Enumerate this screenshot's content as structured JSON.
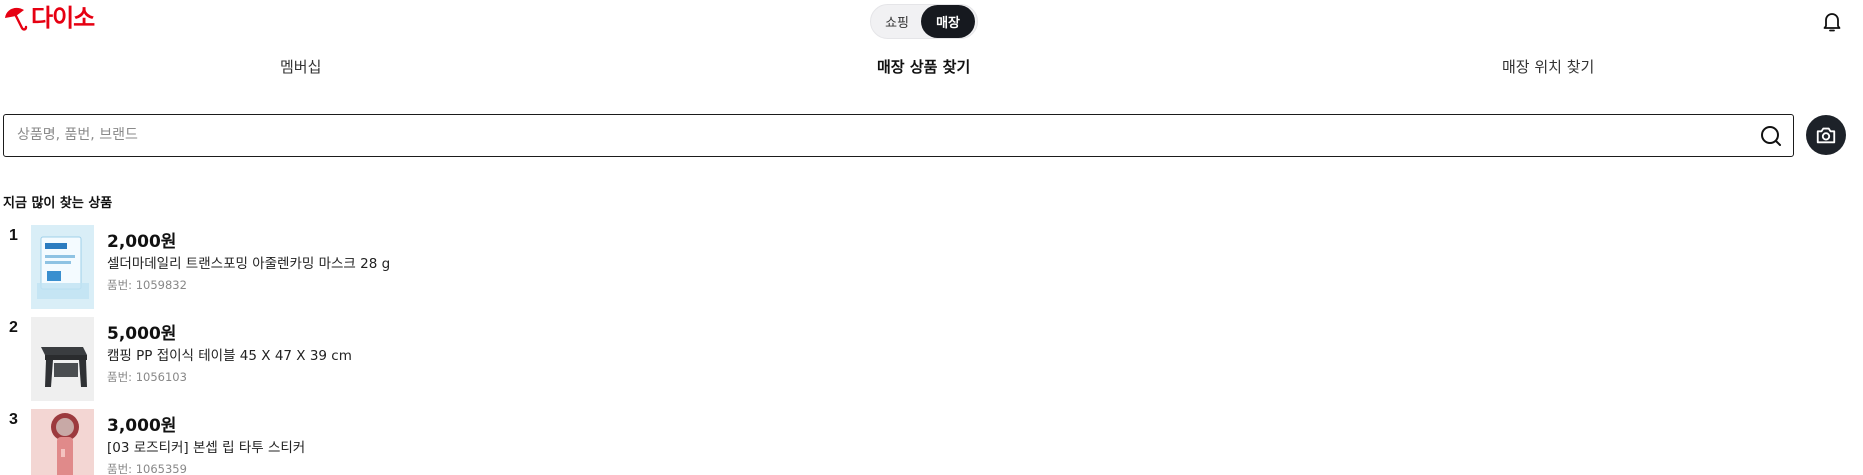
{
  "header": {
    "logo_text": "다이소",
    "toggle": {
      "shopping_label": "쇼핑",
      "store_label": "매장",
      "selected": "매장"
    }
  },
  "tabs": [
    {
      "label": "멤버십"
    },
    {
      "label": "매장 상품 찾기",
      "active": true
    },
    {
      "label": "매장 위치 찾기"
    }
  ],
  "search": {
    "value": "",
    "placeholder": "상품명, 품번, 브랜드"
  },
  "section": {
    "title": "지금 많이 찾는 상품"
  },
  "products": [
    {
      "rank": "1",
      "price": "2,000원",
      "name": "셀더마데일리 트랜스포밍 아줄렌카밍 마스크 28 g",
      "code": "품번: 1059832"
    },
    {
      "rank": "2",
      "price": "5,000원",
      "name": "캠핑 PP 접이식 테이블 45 X 47 X 39 cm",
      "code": "품번: 1056103"
    },
    {
      "rank": "3",
      "price": "3,000원",
      "name": "[03 로즈티커] 본셉 립 타투 스티커",
      "code": "품번: 1065359"
    }
  ],
  "colors": {
    "brand": "#e60012",
    "dark": "#16191f"
  }
}
